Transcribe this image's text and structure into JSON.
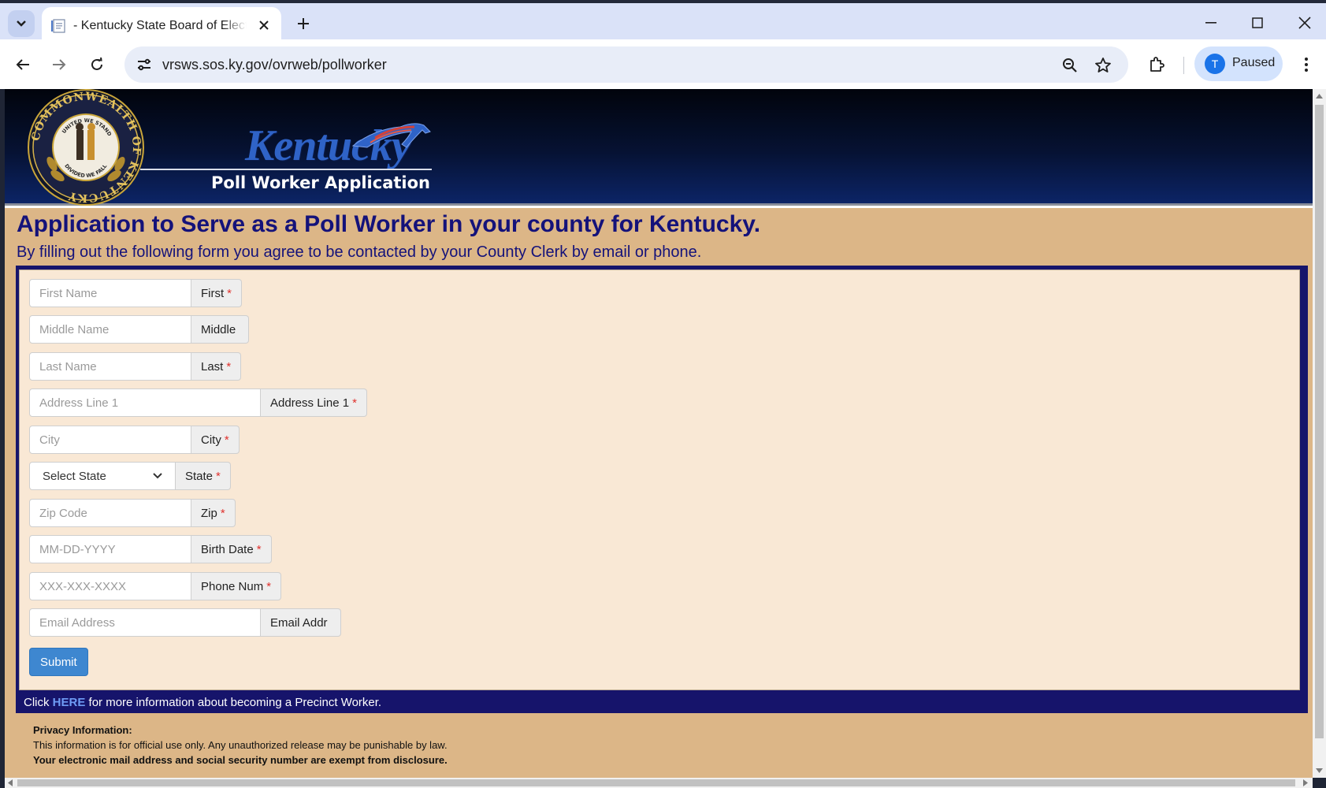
{
  "browser": {
    "tab_title": "- Kentucky State Board of Electi",
    "url": "vrsws.sos.ky.gov/ovrweb/pollworker",
    "profile_initial": "T",
    "profile_status": "Paused"
  },
  "banner": {
    "brand": "Kentucky",
    "subtitle": "Poll Worker Application"
  },
  "page": {
    "heading": "Application to Serve as a Poll Worker in your county for Kentucky.",
    "subheading": "By filling out the following form you agree to be contacted by your County Clerk by email or phone."
  },
  "form": {
    "fields": [
      {
        "placeholder": "First Name",
        "label": "First",
        "required": "*"
      },
      {
        "placeholder": "Middle Name",
        "label": "Middle",
        "required": ""
      },
      {
        "placeholder": "Last Name",
        "label": "Last",
        "required": "*"
      },
      {
        "placeholder": "Address Line 1",
        "label": "Address Line 1",
        "required": "*"
      },
      {
        "placeholder": "City",
        "label": "City",
        "required": "*"
      },
      {
        "placeholder": "Select State",
        "label": "State",
        "required": "*"
      },
      {
        "placeholder": "Zip Code",
        "label": "Zip",
        "required": "*"
      },
      {
        "placeholder": "MM-DD-YYYY",
        "label": "Birth Date",
        "required": "*"
      },
      {
        "placeholder": "XXX-XXX-XXXX",
        "label": "Phone Num",
        "required": "*"
      },
      {
        "placeholder": "Email Address",
        "label": "Email Addr",
        "required": ""
      }
    ],
    "submit_label": "Submit",
    "footer_prefix": "Click",
    "footer_link": "HERE",
    "footer_suffix": "for more information about becoming a Precinct Worker."
  },
  "privacy": {
    "title": "Privacy Information:",
    "line1": "This information is for official use only. Any unauthorized release may be punishable by law.",
    "line2": "Your electronic mail address and social security number are exempt from disclosure."
  },
  "seal": {
    "ring_text": "COMMONWEALTH OF KENTUCKY",
    "motto_top": "UNITED WE STAND",
    "motto_bottom": "DIVIDED WE FALL"
  },
  "colors": {
    "heading": "#14127a",
    "content_bg": "#dcb687",
    "form_bg": "#f9e8d5",
    "submit": "#3e87d0"
  }
}
